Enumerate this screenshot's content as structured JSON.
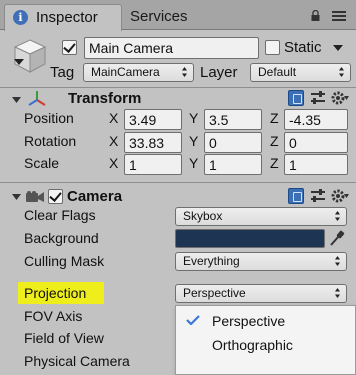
{
  "tabs": {
    "inspector_label": "Inspector",
    "services_label": "Services"
  },
  "header": {
    "active_checked": true,
    "object_name": "Main Camera",
    "static_label": "Static",
    "tag_label": "Tag",
    "tag_value": "MainCamera",
    "layer_label": "Layer",
    "layer_value": "Default"
  },
  "transform": {
    "title": "Transform",
    "position": {
      "label": "Position",
      "x": "3.49",
      "y": "3.5",
      "z": "-4.35"
    },
    "rotation": {
      "label": "Rotation",
      "x": "33.83",
      "y": "0",
      "z": "0"
    },
    "scale": {
      "label": "Scale",
      "x": "1",
      "y": "1",
      "z": "1"
    },
    "axes": {
      "x": "X",
      "y": "Y",
      "z": "Z"
    }
  },
  "camera": {
    "title": "Camera",
    "enabled": true,
    "clear_flags": {
      "label": "Clear Flags",
      "value": "Skybox"
    },
    "background": {
      "label": "Background",
      "color": "#1e3453"
    },
    "culling_mask": {
      "label": "Culling Mask",
      "value": "Everything"
    },
    "projection": {
      "label": "Projection",
      "value": "Perspective"
    },
    "fov_axis": {
      "label": "FOV Axis"
    },
    "field_of_view": {
      "label": "Field of View"
    },
    "physical_camera": {
      "label": "Physical Camera"
    }
  },
  "projection_popup": {
    "options": [
      {
        "label": "Perspective",
        "selected": true
      },
      {
        "label": "Orthographic",
        "selected": false
      }
    ]
  },
  "colors": {
    "panel_bg": "#c2c2c2",
    "highlight": "#eeee1c",
    "accent_blue": "#3b6fb6"
  }
}
